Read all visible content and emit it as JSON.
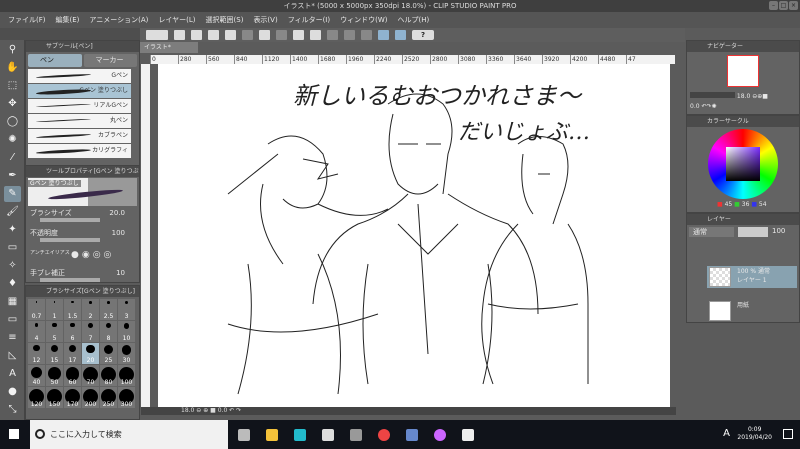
{
  "window": {
    "title": "イラスト* (5000 x 5000px 350dpi 18.0%) - CLIP STUDIO PAINT PRO"
  },
  "menu": [
    "ファイル(F)",
    "編集(E)",
    "アニメーション(A)",
    "レイヤー(L)",
    "選択範囲(S)",
    "表示(V)",
    "フィルター(I)",
    "ウィンドウ(W)",
    "ヘルプ(H)"
  ],
  "toolbar": {
    "help": "?"
  },
  "subtool": {
    "title": "サブツール[ペン]",
    "tabs": [
      "ペン",
      "マーカー"
    ],
    "brushes": [
      "Gペン",
      "Gペン 塗りつぶし",
      "リアルGペン",
      "丸ペン",
      "カブラペン",
      "カリグラフィ"
    ]
  },
  "toolprop": {
    "title": "ツールプロパティ[Gペン 塗りつぶし]",
    "preview": "Gペン 塗りつぶし",
    "brush_size_label": "ブラシサイズ",
    "brush_size": "20.0",
    "opacity_label": "不透明度",
    "opacity": "100",
    "antialias_label": "アンチエイリアス",
    "stabilization_label": "手ブレ補正",
    "stabilization": "10"
  },
  "brushsize": {
    "title": "ブラシサイズ[Gペン 塗りつぶし]",
    "sizes": [
      "0.7",
      "1",
      "1.5",
      "2",
      "2.5",
      "3",
      "4",
      "5",
      "6",
      "7",
      "8",
      "10",
      "12",
      "15",
      "17",
      "20",
      "25",
      "30",
      "40",
      "50",
      "60",
      "70",
      "80",
      "100",
      "120",
      "150",
      "170",
      "200",
      "250",
      "300"
    ],
    "selected": "20"
  },
  "document": {
    "tab": "イラスト*",
    "ruler": [
      "0",
      "280",
      "560",
      "840",
      "1120",
      "1400",
      "1680",
      "1960",
      "2240",
      "2520",
      "2800",
      "3080",
      "3360",
      "3640",
      "3920",
      "4200",
      "4480",
      "47"
    ],
    "zoom": "18.0",
    "rotation": "0.0"
  },
  "canvas_text": {
    "line1": "新しいるむおつかれさま〜",
    "line2": "だいじょぶ…"
  },
  "navigator": {
    "title": "ナビゲーター",
    "zoom": "18.0",
    "rotation": "0.0"
  },
  "color": {
    "title": "カラーサークル",
    "r": "45",
    "g": "36",
    "b": "54",
    "current": "#2d2436"
  },
  "layers": {
    "title": "レイヤー",
    "blend": "通常",
    "opacity": "100",
    "items": [
      {
        "info": "100 % 通常",
        "name": "レイヤー 1"
      },
      {
        "info": "",
        "name": "用紙"
      }
    ]
  },
  "taskbar": {
    "search_placeholder": "ここに入力して検索",
    "time": "0:09",
    "date": "2019/04/20",
    "ime": "A"
  }
}
